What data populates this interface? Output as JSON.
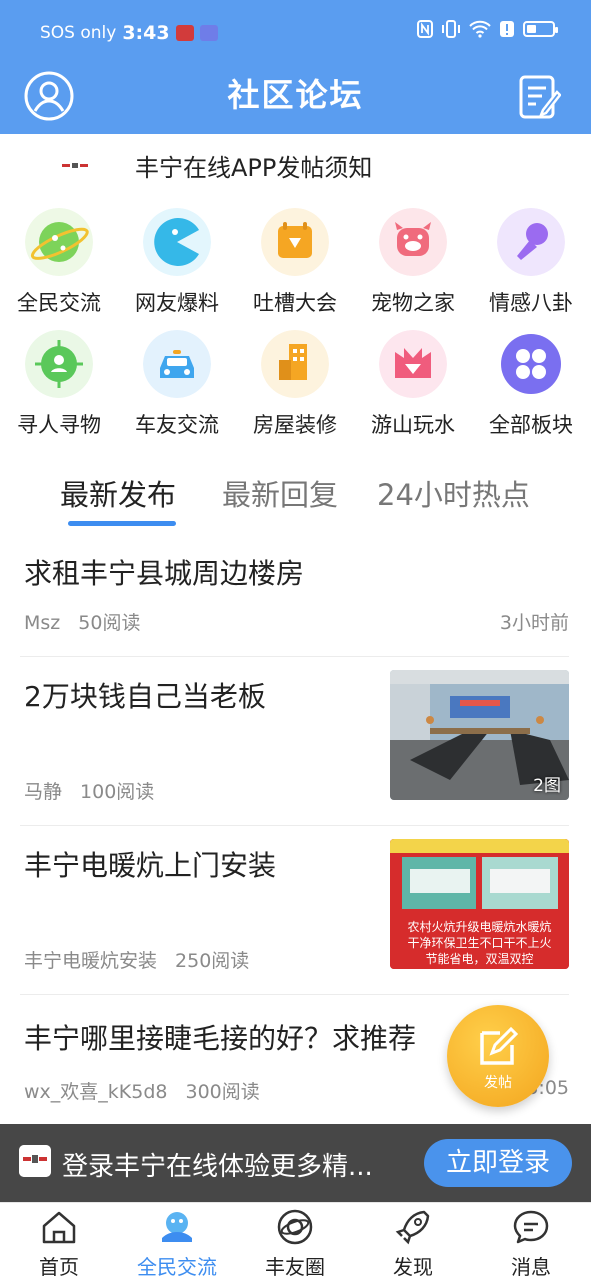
{
  "status_bar": {
    "sos": "SOS only",
    "time": "3:43",
    "right_icons": [
      "nfc-icon",
      "vibrate-icon",
      "wifi-icon",
      "alert-icon",
      "battery-icon"
    ]
  },
  "header": {
    "title": "社区论坛",
    "bg_color": "#5a9df0"
  },
  "notice": {
    "text": "丰宁在线APP发帖须知"
  },
  "categories": [
    {
      "label": "全民交流",
      "icon": "planet-icon",
      "color": "#7dd35a"
    },
    {
      "label": "网友爆料",
      "icon": "pacman-icon",
      "color": "#35b8e8"
    },
    {
      "label": "吐槽大会",
      "icon": "calendar-icon",
      "color": "#f5a623"
    },
    {
      "label": "宠物之家",
      "icon": "pig-icon",
      "color": "#f06b7d"
    },
    {
      "label": "情感八卦",
      "icon": "microphone-icon",
      "color": "#9b6bf0"
    },
    {
      "label": "寻人寻物",
      "icon": "locate-person-icon",
      "color": "#5ac85a"
    },
    {
      "label": "车友交流",
      "icon": "car-icon",
      "color": "#3fa6ee"
    },
    {
      "label": "房屋装修",
      "icon": "building-icon",
      "color": "#f5a623"
    },
    {
      "label": "游山玩水",
      "icon": "mountain-icon",
      "color": "#f05c7d"
    },
    {
      "label": "全部板块",
      "icon": "clover-icon",
      "color": "#7a6ff0"
    }
  ],
  "tabs": [
    {
      "label": "最新发布",
      "active": true
    },
    {
      "label": "最新回复",
      "active": false
    },
    {
      "label": "24小时热点",
      "active": false
    }
  ],
  "posts": [
    {
      "title": "求租丰宁县城周边楼房",
      "author": "Msz",
      "reads": "50阅读",
      "time": "3小时前"
    },
    {
      "title": "2万块钱自己当老板",
      "author": "马静",
      "reads": "100阅读",
      "image_count": "2图"
    },
    {
      "title": "丰宁电暖炕上门安装",
      "author": "丰宁电暖炕安装",
      "reads": "250阅读",
      "image_caption": [
        "农村火炕升级电暖炕水暖炕",
        "干净环保卫生不口干不上火",
        "节能省电，双温双控"
      ]
    },
    {
      "title": "丰宁哪里接睫毛接的好？求推荐",
      "author": "wx_欢喜_kK5d8",
      "reads": "300阅读",
      "time": "3:05"
    }
  ],
  "fab": {
    "label": "发帖"
  },
  "login_banner": {
    "text": "登录丰宁在线体验更多精...",
    "button": "立即登录"
  },
  "bottom_nav": [
    {
      "label": "首页",
      "icon": "home-icon",
      "active": false
    },
    {
      "label": "全民交流",
      "icon": "community-icon",
      "active": true
    },
    {
      "label": "丰友圈",
      "icon": "planet-ring-icon",
      "active": false
    },
    {
      "label": "发现",
      "icon": "rocket-icon",
      "active": false
    },
    {
      "label": "消息",
      "icon": "message-icon",
      "active": false
    }
  ],
  "colors": {
    "accent": "#3d8df0",
    "text": "#222222",
    "muted": "#8a8a8a"
  }
}
